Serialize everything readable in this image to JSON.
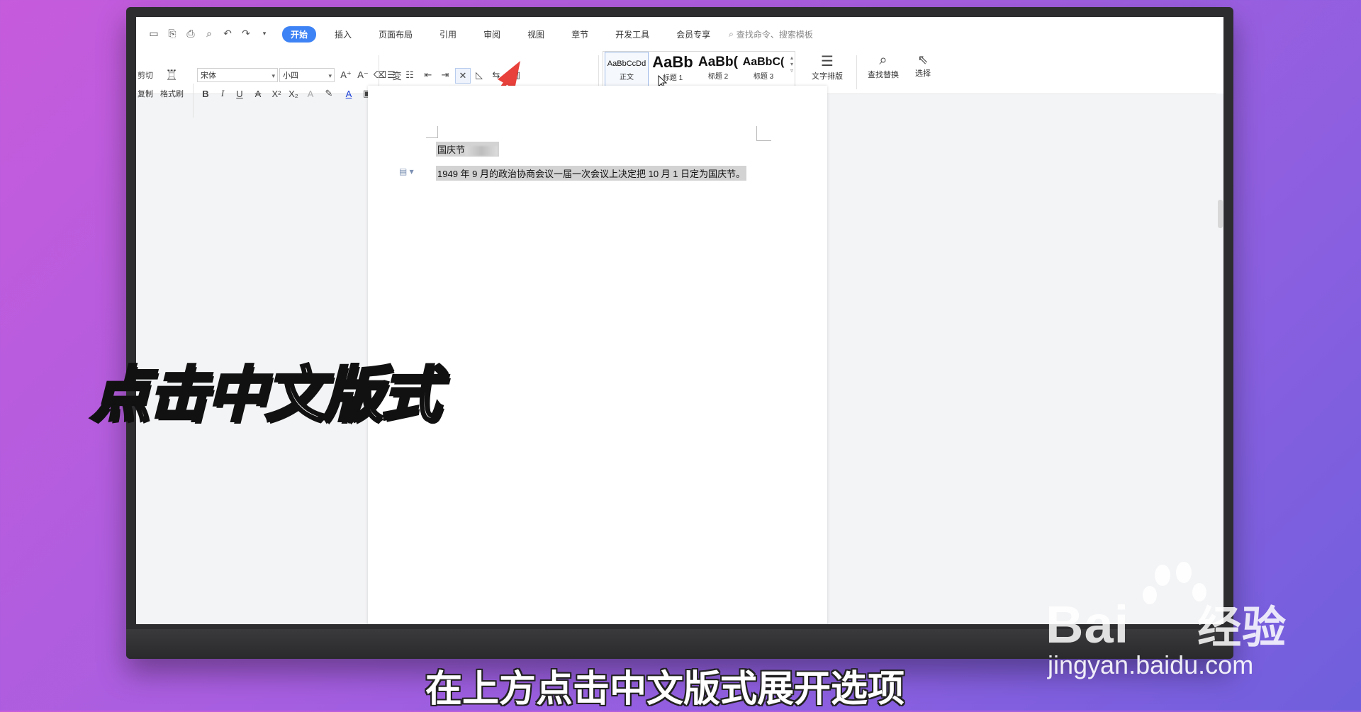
{
  "app": {
    "tabs": [
      {
        "label": "开始",
        "active": true
      },
      {
        "label": "插入"
      },
      {
        "label": "页面布局"
      },
      {
        "label": "引用"
      },
      {
        "label": "审阅"
      },
      {
        "label": "视图"
      },
      {
        "label": "章节"
      },
      {
        "label": "开发工具"
      },
      {
        "label": "会员专享"
      }
    ],
    "search_commands": "查找命令、搜索模板"
  },
  "ribbon": {
    "clipboard": {
      "cut": "剪切",
      "copy": "复制",
      "format_painter": "格式刷"
    },
    "font": {
      "family": "宋体",
      "size": "小四"
    },
    "styles": [
      {
        "preview": "AaBbCcDd",
        "name": "正文"
      },
      {
        "preview": "AaBb",
        "name": "标题 1"
      },
      {
        "preview": "AaBb(",
        "name": "标题 2"
      },
      {
        "preview": "AaBbC(",
        "name": "标题 3"
      }
    ],
    "text_layout": "文字排版",
    "find_replace": "查找替换",
    "select": "选择"
  },
  "document": {
    "line1": "国庆节",
    "line2": "1949 年 9 月的政治协商会议一届一次会议上决定把 10 月 1 日定为国庆节。"
  },
  "overlay": {
    "title": "点击中文版式",
    "subtitle": "在上方点击中文版式展开选项"
  },
  "watermark": {
    "brand": "Bai",
    "brand_suffix": "经验",
    "url": "jingyan.baidu.com"
  },
  "colors": {
    "accent": "#3e83f5",
    "arrow": "#e8403a",
    "background": "#b65ede"
  }
}
